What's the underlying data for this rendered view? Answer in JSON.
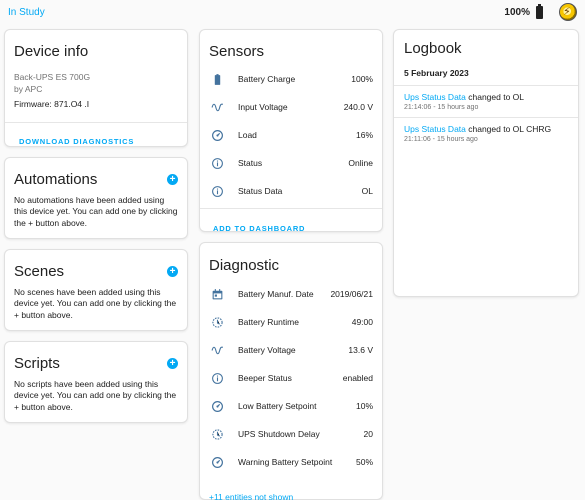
{
  "topbar": {
    "back_label": "In Study",
    "battery_percent": "100%"
  },
  "device_info": {
    "title": "Device info",
    "model": "Back-UPS ES 700G",
    "manufacturer": "by APC",
    "firmware_label": "Firmware:",
    "firmware_value": "871.O4 .I",
    "download_button": "DOWNLOAD DIAGNOSTICS"
  },
  "automations": {
    "title": "Automations",
    "text": "No automations have been added using this device yet. You can add one by clicking the + button above."
  },
  "scenes": {
    "title": "Scenes",
    "text": "No scenes have been added using this device yet. You can add one by clicking the + button above."
  },
  "scripts": {
    "title": "Scripts",
    "text": "No scripts have been added using this device yet. You can add one by clicking the + button above."
  },
  "sensors": {
    "title": "Sensors",
    "rows": [
      {
        "icon": "battery-icon",
        "name": "Battery Charge",
        "value": "100%"
      },
      {
        "icon": "sine-wave-icon",
        "name": "Input Voltage",
        "value": "240.0 V"
      },
      {
        "icon": "gauge-icon",
        "name": "Load",
        "value": "16%"
      },
      {
        "icon": "info-icon",
        "name": "Status",
        "value": "Online"
      },
      {
        "icon": "info-icon",
        "name": "Status Data",
        "value": "OL"
      }
    ],
    "add_button": "ADD TO DASHBOARD"
  },
  "diagnostic": {
    "title": "Diagnostic",
    "rows": [
      {
        "icon": "calendar-icon",
        "name": "Battery Manuf. Date",
        "value": "2019/06/21"
      },
      {
        "icon": "timer-icon",
        "name": "Battery Runtime",
        "value": "49:00"
      },
      {
        "icon": "sine-wave-icon",
        "name": "Battery Voltage",
        "value": "13.6 V"
      },
      {
        "icon": "info-icon",
        "name": "Beeper Status",
        "value": "enabled"
      },
      {
        "icon": "gauge-icon",
        "name": "Low Battery Setpoint",
        "value": "10%"
      },
      {
        "icon": "timer-icon",
        "name": "UPS Shutdown Delay",
        "value": "20"
      },
      {
        "icon": "gauge-icon",
        "name": "Warning Battery Setpoint",
        "value": "50%"
      }
    ],
    "more_link": "+11 entities not shown"
  },
  "logbook": {
    "title": "Logbook",
    "date": "5 February 2023",
    "entries": [
      {
        "entity": "Ups Status Data",
        "action": " changed to OL",
        "time": "21:14:06 - 15 hours ago"
      },
      {
        "entity": "Ups Status Data",
        "action": " changed to OL CHRG",
        "time": "21:11:06 - 15 hours ago"
      }
    ]
  },
  "colors": {
    "accent": "#03a9f4",
    "icon": "#44739e"
  }
}
